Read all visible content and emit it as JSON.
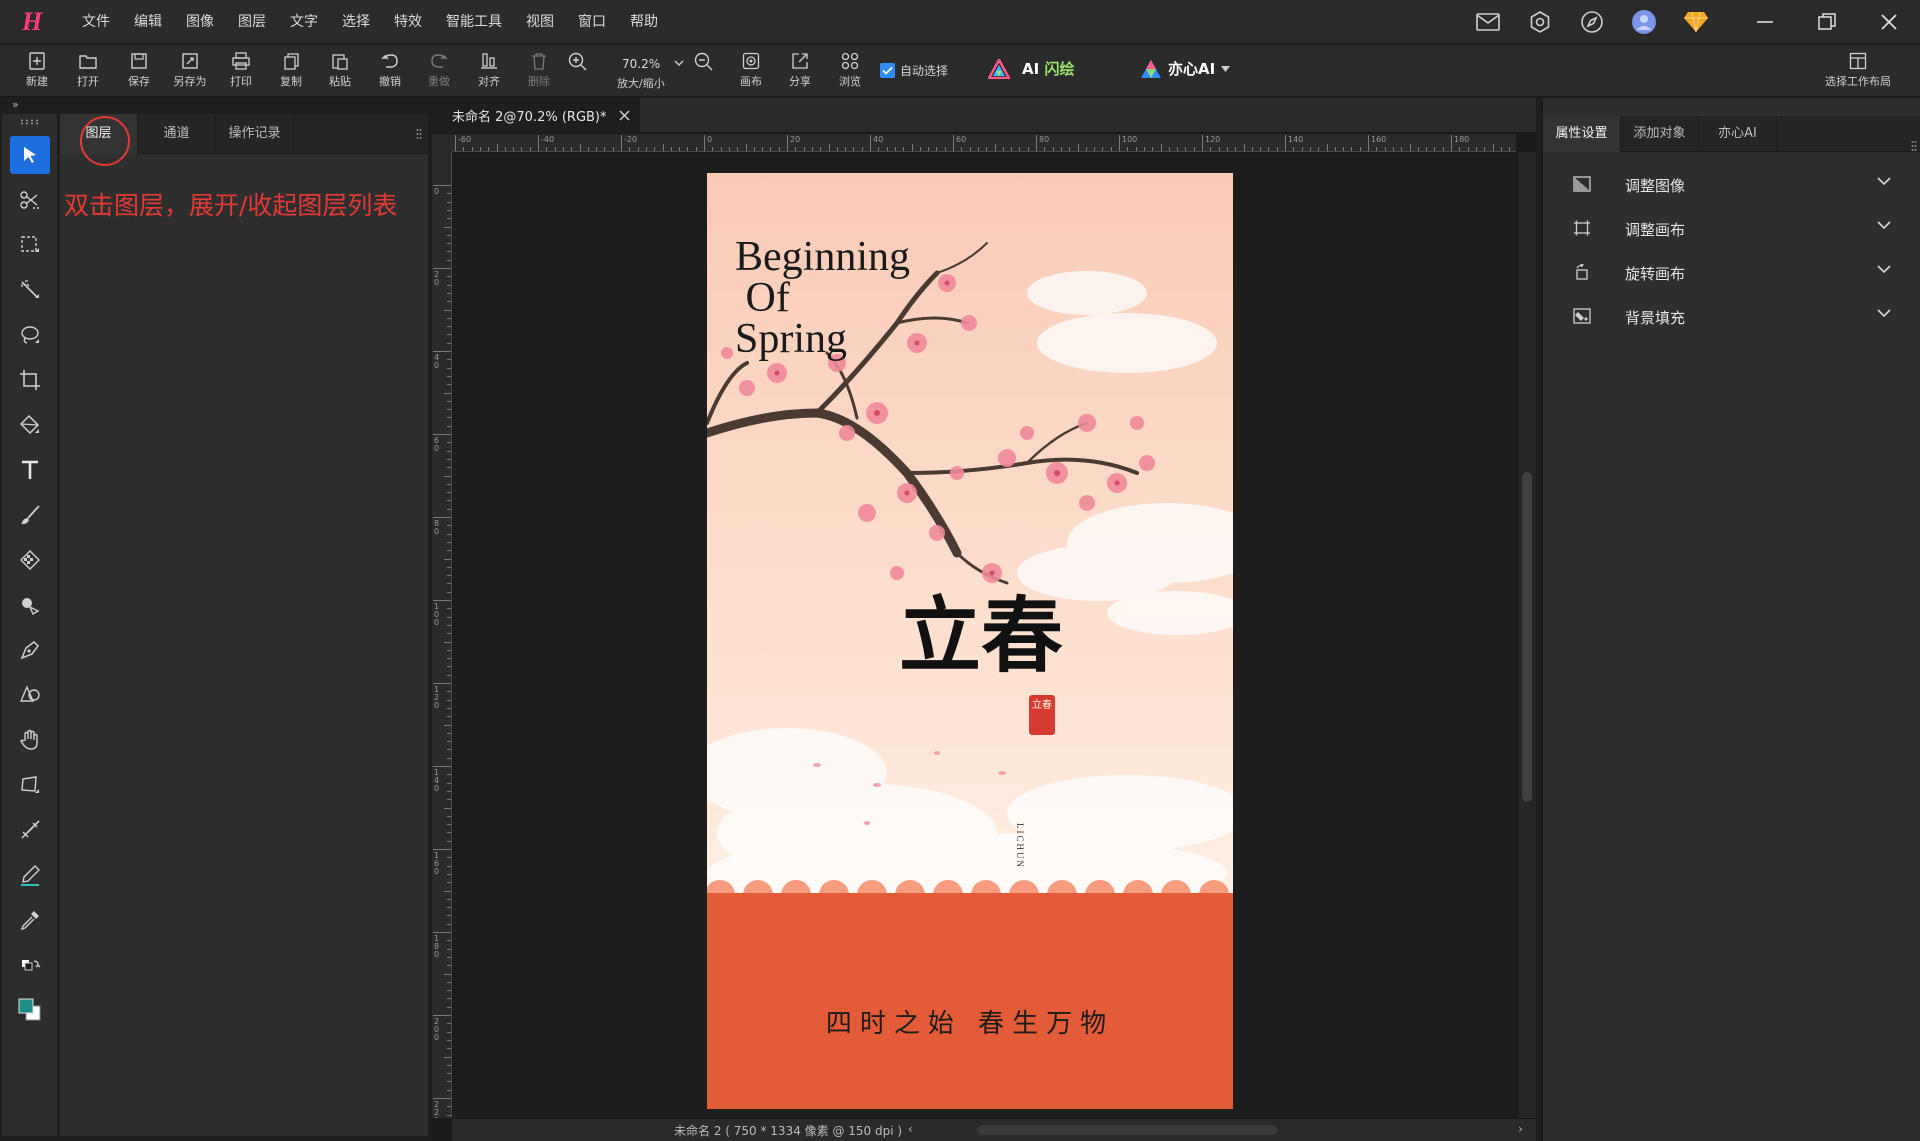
{
  "app": {
    "logo": "H"
  },
  "menu": [
    "文件",
    "编辑",
    "图像",
    "图层",
    "文字",
    "选择",
    "特效",
    "智能工具",
    "视图",
    "窗口",
    "帮助"
  ],
  "toolbar": {
    "buttons": [
      {
        "label": "新建",
        "icon": "new-file-icon"
      },
      {
        "label": "打开",
        "icon": "open-folder-icon"
      },
      {
        "label": "保存",
        "icon": "save-icon"
      },
      {
        "label": "另存为",
        "icon": "save-as-icon"
      },
      {
        "label": "打印",
        "icon": "print-icon"
      },
      {
        "label": "复制",
        "icon": "copy-icon"
      },
      {
        "label": "粘贴",
        "icon": "paste-icon"
      },
      {
        "label": "撤销",
        "icon": "undo-icon"
      },
      {
        "label": "重做",
        "icon": "redo-icon"
      },
      {
        "label": "对齐",
        "icon": "align-icon"
      },
      {
        "label": "删除",
        "icon": "delete-icon"
      }
    ],
    "zoom_in_icon": "zoom-in-icon",
    "zoom_value": "70.2%",
    "zoom_label": "放大/缩小",
    "zoom_out_icon": "zoom-out-icon",
    "right_buttons": [
      {
        "label": "画布",
        "icon": "canvas-icon"
      },
      {
        "label": "分享",
        "icon": "share-icon"
      },
      {
        "label": "浏览",
        "icon": "browse-icon"
      }
    ],
    "auto_select": {
      "label": "自动选择",
      "checked": true
    },
    "ai_draw": {
      "label_prefix": "AI",
      "label_highlight": "闪绘",
      "highlight_color": "#9be36c"
    },
    "yixin_ai": {
      "label": "亦心AI"
    },
    "workspace": {
      "label": "选择工作布局"
    }
  },
  "tools": [
    "move-select-icon",
    "magic-cut-icon",
    "rect-select-icon",
    "magic-wand-icon",
    "lasso-icon",
    "crop-icon",
    "fill-icon",
    "text-icon",
    "brush-icon",
    "mosaic-icon",
    "clone-icon",
    "pen-icon",
    "shape-icon",
    "hand-icon",
    "transform-icon",
    "healing-icon",
    "gradient-pen-icon",
    "eyedropper-icon",
    "swap-colors-icon",
    "color-swatch-icon"
  ],
  "left_panel": {
    "tabs": [
      "图层",
      "通道",
      "操作记录"
    ],
    "active_tab": "图层",
    "hint": "双击图层，展开/收起图层列表",
    "hint_color": "#e53935"
  },
  "document": {
    "tab_title": "未命名 2@70.2% (RGB)*",
    "status": "未命名 2 ( 750 * 1334 像素 @ 150 dpi )",
    "hruler_labels": [
      "-60",
      "-40",
      "-20",
      "0",
      "20",
      "40",
      "60",
      "80",
      "100",
      "120",
      "140",
      "160",
      "180"
    ],
    "vruler_labels": [
      "0",
      "20",
      "40",
      "60",
      "80",
      "100",
      "120",
      "140",
      "160",
      "180",
      "200",
      "220"
    ]
  },
  "poster": {
    "title": "Beginning\n Of\nSpring",
    "calligraphy": "立春",
    "seal": "立春",
    "lichun": "LICHUN",
    "motto": "四时之始 春生万物",
    "band_color": "#e35b37"
  },
  "right_panel": {
    "tabs": [
      "属性设置",
      "添加对象",
      "亦心AI"
    ],
    "active_tab": "属性设置",
    "rows": [
      {
        "label": "调整图像",
        "icon": "adjust-image-icon"
      },
      {
        "label": "调整画布",
        "icon": "adjust-canvas-icon"
      },
      {
        "label": "旋转画布",
        "icon": "rotate-canvas-icon"
      },
      {
        "label": "背景填充",
        "icon": "background-fill-icon"
      }
    ]
  },
  "top_right_icons": [
    "mail-icon",
    "settings-icon",
    "compass-icon",
    "avatar",
    "vip-diamond-icon"
  ],
  "window_buttons": [
    "minimize-icon",
    "restore-icon",
    "close-icon"
  ]
}
